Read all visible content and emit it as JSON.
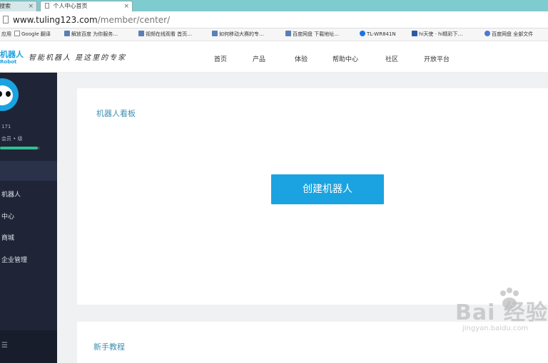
{
  "browser": {
    "tabs": [
      {
        "label": "搜索",
        "close": "×"
      },
      {
        "label": "个人中心首页",
        "close": "×"
      }
    ],
    "url_host": "www.tuling123.com",
    "url_path": "/member/center/"
  },
  "bookmarks": {
    "apps_label": "应用",
    "items": [
      "Google 翻译",
      "解放百度 为你服务…",
      "视频在线观看 首页…",
      "如何移动大赛的专…",
      "百度网盘 下载地址…",
      "TL-WR841N",
      "hi天使 · hi精彩下…",
      "百度网盘 全部文件"
    ]
  },
  "header": {
    "logo_cn": "机器人",
    "logo_en": "Robot",
    "slogan": "智能机器人 是这里的专家",
    "nav": [
      "首页",
      "产品",
      "体验",
      "帮助中心",
      "社区",
      "开放平台"
    ]
  },
  "sidebar": {
    "user_id": "171",
    "user_level": "会员 • 级",
    "progress_fraction": 0.95,
    "items": [
      "机器人",
      "中心",
      "商城",
      "企业管理"
    ]
  },
  "main": {
    "board_title": "机器人看板",
    "create_button": "创建机器人",
    "tutorial_title": "新手教程"
  },
  "watermark": {
    "text": "Bai 经验",
    "sub": "jingyan.baidu.com"
  },
  "colors": {
    "accent": "#1aa3e0",
    "sidebar": "#1f2537",
    "progress": "#2fc08f"
  }
}
